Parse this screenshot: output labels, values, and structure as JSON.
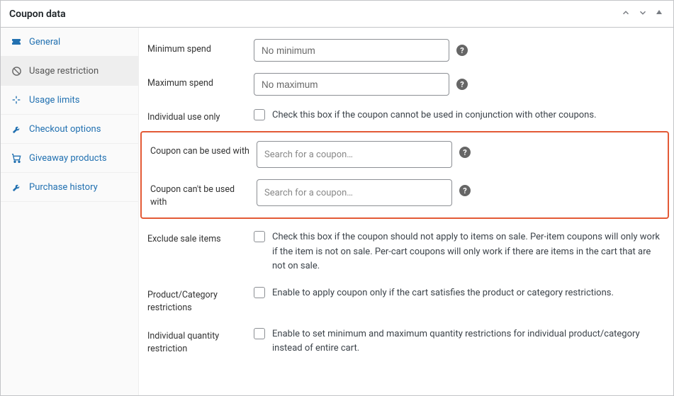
{
  "panel": {
    "title": "Coupon data"
  },
  "sidebar": {
    "items": [
      {
        "label": "General"
      },
      {
        "label": "Usage restriction"
      },
      {
        "label": "Usage limits"
      },
      {
        "label": "Checkout options"
      },
      {
        "label": "Giveaway products"
      },
      {
        "label": "Purchase history"
      }
    ]
  },
  "fields": {
    "min_spend": {
      "label": "Minimum spend",
      "placeholder": "No minimum"
    },
    "max_spend": {
      "label": "Maximum spend",
      "placeholder": "No maximum"
    },
    "individual_use": {
      "label": "Individual use only",
      "text": "Check this box if the coupon cannot be used in conjunction with other coupons."
    },
    "use_with": {
      "label": "Coupon can be used with",
      "placeholder": "Search for a coupon…"
    },
    "not_use_with": {
      "label": "Coupon can't be used with",
      "placeholder": "Search for a coupon…"
    },
    "exclude_sale": {
      "label": "Exclude sale items",
      "text": "Check this box if the coupon should not apply to items on sale. Per-item coupons will only work if the item is not on sale. Per-cart coupons will only work if there are items in the cart that are not on sale."
    },
    "prod_cat": {
      "label": "Product/Category restrictions",
      "text": "Enable to apply coupon only if the cart satisfies the product or category restrictions."
    },
    "ind_qty": {
      "label": "Individual quantity restriction",
      "text": "Enable to set minimum and maximum quantity restrictions for individual product/category instead of entire cart."
    }
  }
}
